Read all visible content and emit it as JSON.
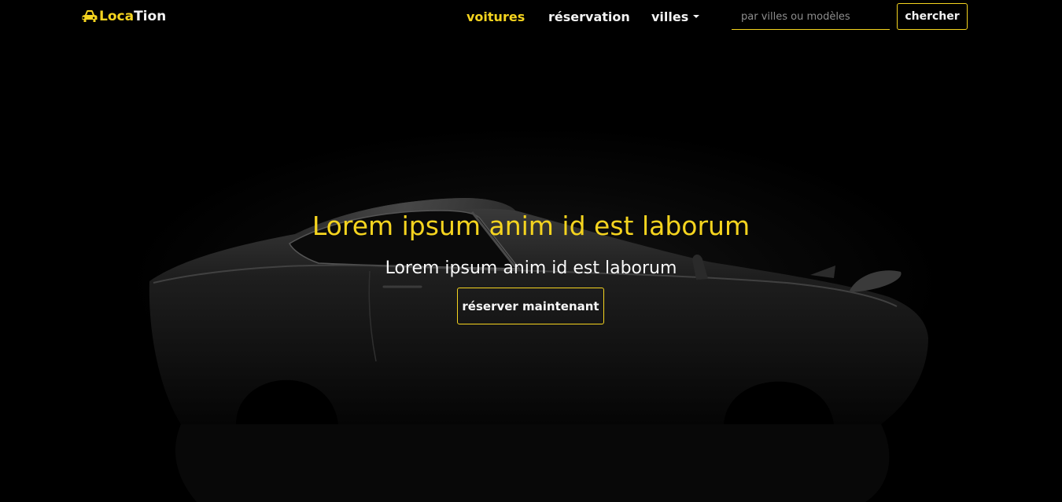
{
  "brand": {
    "part1": "Loca",
    "part2": "Tion",
    "icon": "car-icon"
  },
  "nav": {
    "items": [
      {
        "label": "voitures",
        "active": true
      },
      {
        "label": "réservation",
        "active": false
      },
      {
        "label": "villes",
        "active": false,
        "dropdown": true
      }
    ]
  },
  "search": {
    "placeholder": "par villes ou modèles",
    "value": "",
    "button_label": "chercher"
  },
  "hero": {
    "title": "Lorem ipsum anim id est laborum",
    "subtitle": "Lorem ipsum anim id est laborum",
    "cta_label": "réserver maintenant"
  },
  "colors": {
    "accent": "#f5d41f",
    "background": "#000000",
    "text": "#f2f2f2"
  }
}
